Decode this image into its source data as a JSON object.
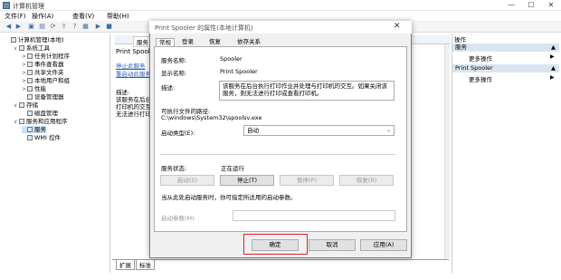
{
  "window": {
    "title": "计算机管理",
    "minimize": "—",
    "maximize": "☐",
    "close": "✕"
  },
  "menu": [
    "文件(F)",
    "操作(A)",
    "查看(V)",
    "帮助(H)"
  ],
  "tree": [
    {
      "label": "计算机管理(本地)",
      "exp": "",
      "level": 0
    },
    {
      "label": "系统工具",
      "exp": "∨",
      "level": 1
    },
    {
      "label": "任务计划程序",
      "exp": ">",
      "level": 2
    },
    {
      "label": "事件查看器",
      "exp": ">",
      "level": 2
    },
    {
      "label": "共享文件夹",
      "exp": ">",
      "level": 2
    },
    {
      "label": "本地用户和组",
      "exp": ">",
      "level": 2
    },
    {
      "label": "性能",
      "exp": ">",
      "level": 2
    },
    {
      "label": "设备管理器",
      "exp": "",
      "level": 2
    },
    {
      "label": "存储",
      "exp": "∨",
      "level": 1
    },
    {
      "label": "磁盘管理",
      "exp": "",
      "level": 2
    },
    {
      "label": "服务和应用程序",
      "exp": "∨",
      "level": 1
    },
    {
      "label": "服务",
      "exp": "",
      "level": 2
    },
    {
      "label": "WMI 控件",
      "exp": "",
      "level": 2
    }
  ],
  "middle": {
    "header_tab": "服务",
    "header_title": "Print Spooler",
    "link_stop": "停止此服务",
    "link_restart": "重启动此服务",
    "desc_label": "描述:",
    "desc_lines": [
      "该服务在后台",
      "打印机的交互",
      "无法进行打印"
    ],
    "bottom_tabs": [
      "扩展",
      "标准"
    ]
  },
  "actions": {
    "title": "操作",
    "sections": [
      {
        "header": "服务",
        "item": "更多操作"
      },
      {
        "header": "Print Spooler",
        "item": "更多操作"
      }
    ]
  },
  "dialog": {
    "title": "Print Spooler 的属性(本地计算机)",
    "close": "✕",
    "tabs": [
      "常规",
      "登录",
      "恢复",
      "依存关系"
    ],
    "service_name_label": "服务名称:",
    "service_name": "Spooler",
    "display_name_label": "显示名称:",
    "display_name": "Print Spooler",
    "description_label": "描述:",
    "description": "该服务在后台执行打印作业并处理与打印机的交互。如果关闭该服务，则无法进行打印或查看打印机。",
    "path_label": "可执行文件的路径:",
    "path": "C:\\windows\\System32\\spoolsv.exe",
    "startup_label": "启动类型(E):",
    "startup_value": "自动",
    "status_label": "服务状态:",
    "status_value": "正在运行",
    "buttons": {
      "start": "启动(S)",
      "stop": "停止(T)",
      "pause": "暂停(P)",
      "resume": "恢复(R)"
    },
    "hint": "当从此处启动服务时，你可指定所适用的启动参数。",
    "params_label": "启动参数(M):",
    "params_value": "",
    "ok": "确定",
    "cancel": "取消",
    "apply": "应用(A)"
  },
  "colors": {
    "highlight": "#d9262c",
    "accent": "#3a6ea5"
  }
}
